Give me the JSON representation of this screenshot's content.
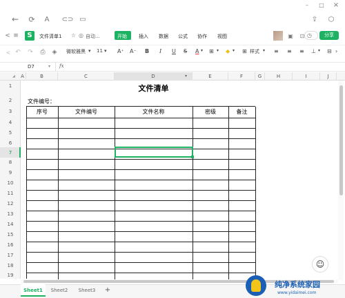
{
  "window": {
    "icons": [
      "back-arrow",
      "refresh",
      "font-a",
      "link",
      "window",
      "share",
      "settings"
    ],
    "controls": {
      "minimize": "–",
      "maximize": "□",
      "close": "×"
    }
  },
  "ribbon": {
    "app_badge": "S",
    "doc_title": "文件清单1",
    "autosave": "自动...",
    "tabs": [
      "开始",
      "插入",
      "数据",
      "公式",
      "协作",
      "视图"
    ],
    "active_tab": "开始",
    "share_button": "分享",
    "accent": "#1db262"
  },
  "toolbar": {
    "font_name": "微软雅黑",
    "font_size": "11",
    "style_label": "样式"
  },
  "formula_bar": {
    "cell_ref": "D7",
    "fx": "fx",
    "value": ""
  },
  "grid": {
    "columns": [
      "A",
      "B",
      "C",
      "D",
      "E",
      "F",
      "G",
      "H",
      "I",
      "J"
    ],
    "rows": [
      "1",
      "2",
      "3",
      "4",
      "5",
      "6",
      "7",
      "8",
      "9",
      "10",
      "11",
      "12",
      "13",
      "14",
      "15",
      "16",
      "17",
      "18",
      "19"
    ],
    "selected_row": "7",
    "title": "文件清单",
    "label_row2": "文件编号：",
    "table_headers": [
      "序号",
      "文件编号",
      "文件名称",
      "密级",
      "备注"
    ]
  },
  "sheets": {
    "tabs": [
      "Sheet1",
      "Sheet2",
      "Sheet3"
    ],
    "active": "Sheet1",
    "add": "+"
  },
  "watermark": {
    "brand": "纯净系统家园",
    "url": "www.yidaimei.com"
  }
}
